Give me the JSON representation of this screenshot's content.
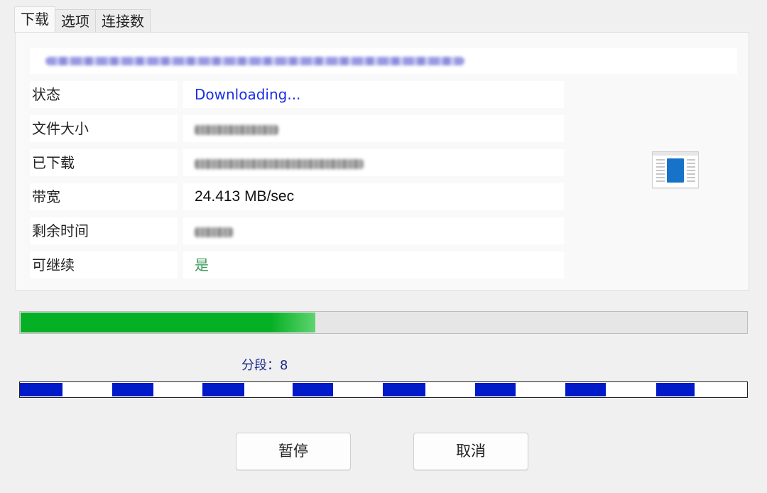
{
  "tabs": [
    {
      "label": "下载",
      "active": true
    },
    {
      "label": "选项",
      "active": false
    },
    {
      "label": "连接数",
      "active": false
    }
  ],
  "rows": [
    {
      "label": "状态",
      "value": "Downloading..."
    },
    {
      "label": "文件大小",
      "value": ""
    },
    {
      "label": "已下载",
      "value": ""
    },
    {
      "label": "带宽",
      "value": "24.413 MB/sec"
    },
    {
      "label": "剩余时间",
      "value": ""
    },
    {
      "label": "可继续",
      "value": "是"
    }
  ],
  "progress": {
    "percent": 40.6,
    "fill_color": "#06b025"
  },
  "segments": {
    "label": "分段：8",
    "count": 8,
    "fills": [
      [
        0.0,
        0.059
      ],
      [
        0.127,
        0.184
      ],
      [
        0.251,
        0.309
      ],
      [
        0.375,
        0.431
      ],
      [
        0.499,
        0.558
      ],
      [
        0.626,
        0.682
      ],
      [
        0.75,
        0.806
      ],
      [
        0.875,
        0.928
      ]
    ],
    "color": "#0019c9"
  },
  "buttons": {
    "pause": "暂停",
    "cancel": "取消"
  },
  "icons": {
    "file": "file-preview-icon"
  }
}
